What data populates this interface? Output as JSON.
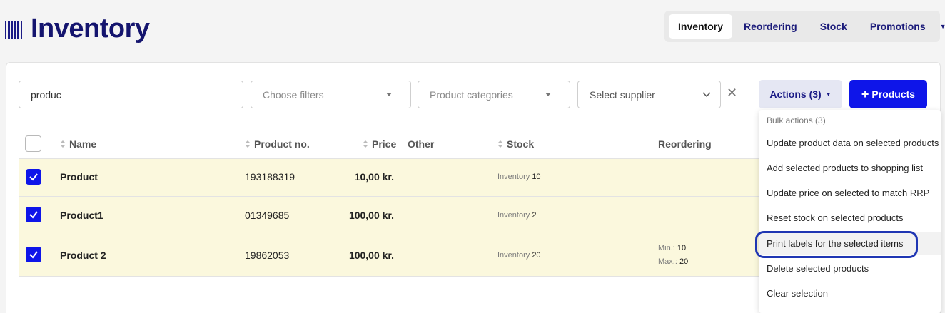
{
  "header": {
    "title": "Inventory",
    "nav": [
      {
        "label": "Inventory",
        "active": true
      },
      {
        "label": "Reordering",
        "active": false
      },
      {
        "label": "Stock",
        "active": false
      },
      {
        "label": "Promotions",
        "active": false
      }
    ],
    "nav_more_icon": "caret-down-icon"
  },
  "filters": {
    "search_value": "produc",
    "filter_placeholder": "Choose filters",
    "categories_placeholder": "Product categories",
    "supplier_placeholder": "Select supplier",
    "clear_icon": "close-icon"
  },
  "actions": {
    "actions_label": "Actions (3)",
    "add_products_label": "Products",
    "add_icon": "plus-icon"
  },
  "table": {
    "columns": [
      "Name",
      "Product no.",
      "Price",
      "Other",
      "Stock",
      "Reordering"
    ],
    "rows": [
      {
        "name": "Product",
        "product_no": "193188319",
        "price": "10,00 kr.",
        "other": "",
        "stock_label": "Inventory",
        "stock_value": "10",
        "reorder_min_label": "",
        "reorder_min": "",
        "reorder_max_label": "",
        "reorder_max": "",
        "checked": true
      },
      {
        "name": "Product1",
        "product_no": "01349685",
        "price": "100,00 kr.",
        "other": "",
        "stock_label": "Inventory",
        "stock_value": "2",
        "reorder_min_label": "",
        "reorder_min": "",
        "reorder_max_label": "",
        "reorder_max": "",
        "checked": true
      },
      {
        "name": "Product 2",
        "product_no": "19862053",
        "price": "100,00 kr.",
        "other": "",
        "stock_label": "Inventory",
        "stock_value": "20",
        "reorder_min_label": "Min.:",
        "reorder_min": "10",
        "reorder_max_label": "Max.:",
        "reorder_max": "20",
        "checked": true
      }
    ]
  },
  "bulk_menu": {
    "header": "Bulk actions (3)",
    "items": [
      "Update product data on selected products",
      "Add selected products to shopping list",
      "Update price on selected to match RRP",
      "Reset stock on selected products",
      "Print labels for the selected items",
      "Delete selected products",
      "Clear selection"
    ],
    "highlighted_index": 4
  },
  "colors": {
    "brand": "#14146e",
    "primary_button": "#0e15e9",
    "selected_row": "#fbf8dd",
    "highlight_ring": "#1f36b3"
  }
}
